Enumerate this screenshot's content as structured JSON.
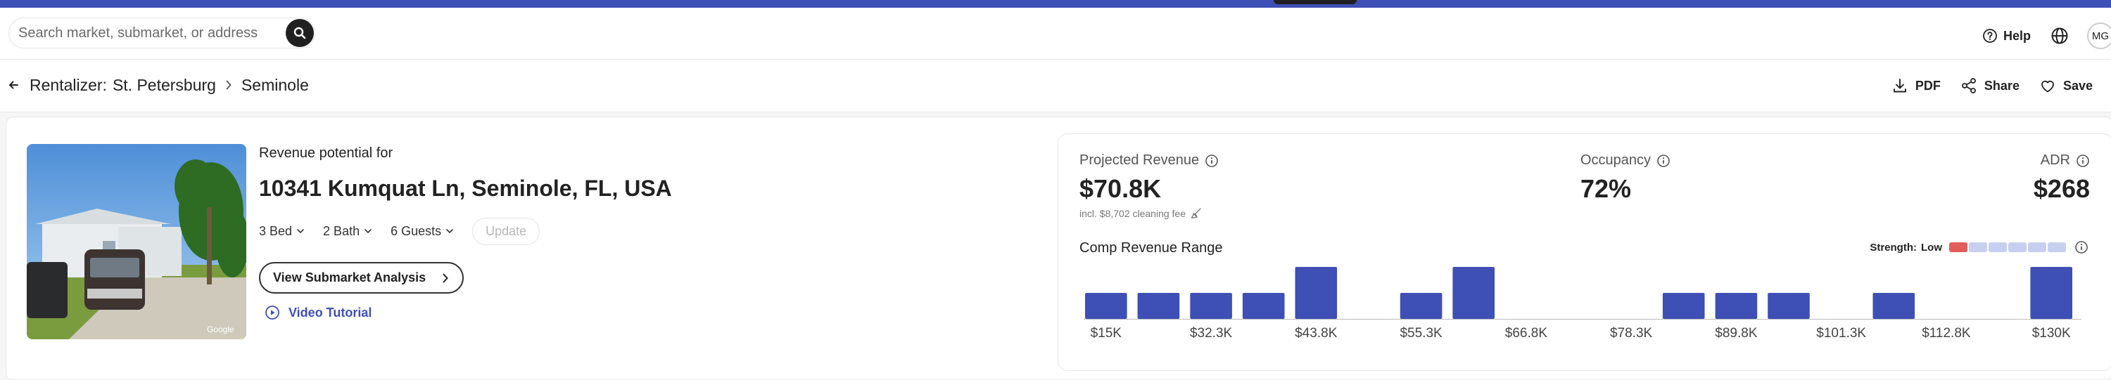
{
  "header": {
    "search_placeholder": "Search market, submarket, or address",
    "help_label": "Help",
    "avatar_initials": "MG",
    "icons": [
      "search-icon",
      "help-icon",
      "globe-icon"
    ]
  },
  "breadcrumb": {
    "root": "Rentalizer:",
    "market": "St. Petersburg",
    "submarket": "Seminole"
  },
  "actions": {
    "pdf": "PDF",
    "share": "Share",
    "save": "Save"
  },
  "property": {
    "label": "Revenue potential for",
    "address": "10341 Kumquat Ln, Seminole, FL, USA",
    "beds": "3 Bed",
    "baths": "2 Bath",
    "guests": "6 Guests",
    "update_label": "Update",
    "vsa_label": "View Submarket Analysis",
    "video_label": "Video Tutorial",
    "photo_watermark": "Google"
  },
  "metrics": {
    "revenue_label": "Projected Revenue",
    "revenue_value": "$70.8K",
    "revenue_sub": "incl. $8,702 cleaning fee",
    "occupancy_label": "Occupancy",
    "occupancy_value": "72%",
    "adr_label": "ADR",
    "adr_value": "$268"
  },
  "comp": {
    "title": "Comp Revenue Range",
    "strength_label": "Strength:",
    "strength_value": "Low",
    "strength_level": 1,
    "strength_segments": 6,
    "colors": {
      "bar": "#3e4fb5",
      "low": "#e25c5c",
      "empty": "#c7cff0"
    }
  },
  "chart_data": {
    "type": "bar",
    "title": "Comp Revenue Range",
    "x_ticks": [
      "$15K",
      "$32.3K",
      "$43.8K",
      "$55.3K",
      "$66.8K",
      "$78.3K",
      "$89.8K",
      "$101.3K",
      "$112.8K",
      "$130K"
    ],
    "bins": 19,
    "values": [
      1,
      1,
      1,
      1,
      2,
      0,
      1,
      2,
      0,
      0,
      0,
      1,
      1,
      1,
      0,
      1,
      0,
      0,
      2
    ],
    "ylim": [
      0,
      2
    ]
  }
}
